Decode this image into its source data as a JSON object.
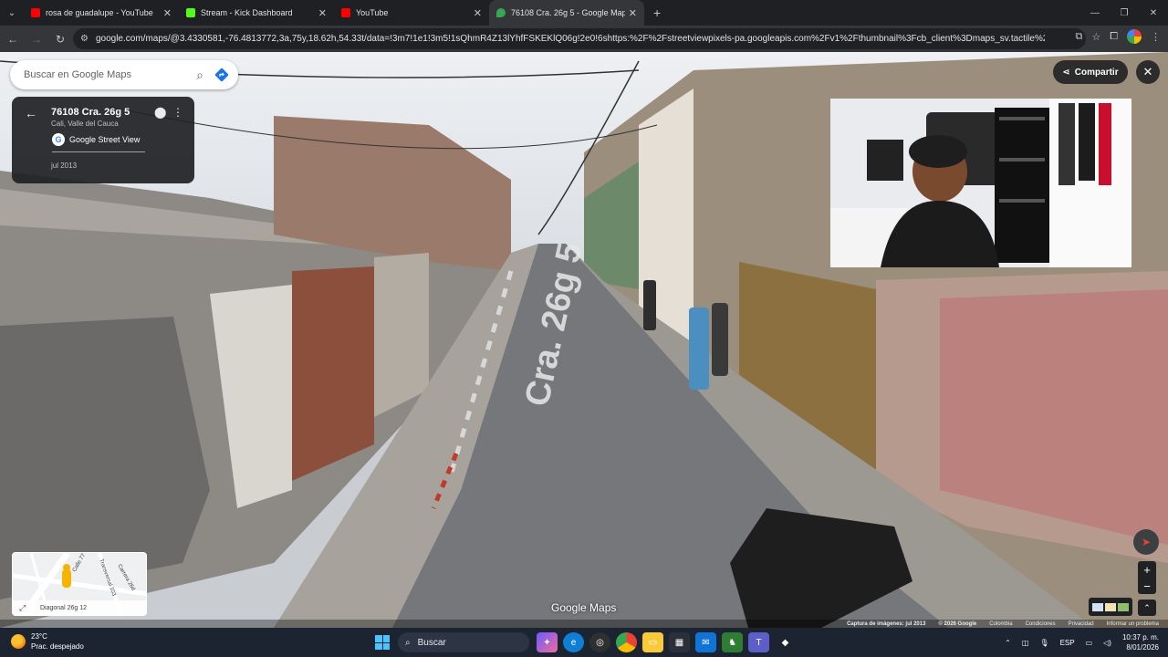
{
  "browser": {
    "tabs": [
      {
        "label": "rosa de guadalupe - YouTube",
        "favicon_color": "#ff0000",
        "active": false
      },
      {
        "label": "Stream - Kick Dashboard",
        "favicon_color": "#53fc18",
        "active": false
      },
      {
        "label": "YouTube",
        "favicon_color": "#ff0000",
        "active": false
      },
      {
        "label": "76108 Cra. 26g 5 - Google Maps",
        "favicon_color": "#34a853",
        "active": true
      }
    ],
    "url": "google.com/maps/@3.4330581,-76.4813772,3a,75y,18.62h,54.33t/data=!3m7!1e1!3m5!1sQhmR4Z13lYhfFSKEKlQ06g!2e0!6shttps:%2F%2Fstreetviewpixels-pa.googleapis.com%2Fv1%2Fthumbnail%3Fcb_client%3Dmaps_sv.tactile%26w%3D900%26h%..."
  },
  "maps": {
    "search_placeholder": "Buscar en Google Maps",
    "card": {
      "address": "76108 Cra. 26g 5",
      "city": "Cali, Valle del Cauca",
      "source": "Google Street View",
      "date": "jul 2013"
    },
    "share_label": "Compartir",
    "street_paint": "Cra. 26g 5",
    "watermark": "Google Maps",
    "minimap": {
      "label": "Diagonal 26g 12",
      "streets": [
        "Calle 77",
        "Transversal 103",
        "Carrera 26d"
      ]
    },
    "footer": {
      "imagery": "Captura de imágenes: jul 2013",
      "copyright": "© 2026 Google",
      "country": "Colombia",
      "terms": "Condiciones",
      "privacy": "Privacidad",
      "report": "Informar un problema"
    },
    "compass_heading": 18.62
  },
  "taskbar": {
    "temp": "23°C",
    "weather": "Prac. despejado",
    "search_placeholder": "Buscar",
    "lang": "ESP",
    "time": "10:37 p. m.",
    "date": "8/01/2026"
  }
}
